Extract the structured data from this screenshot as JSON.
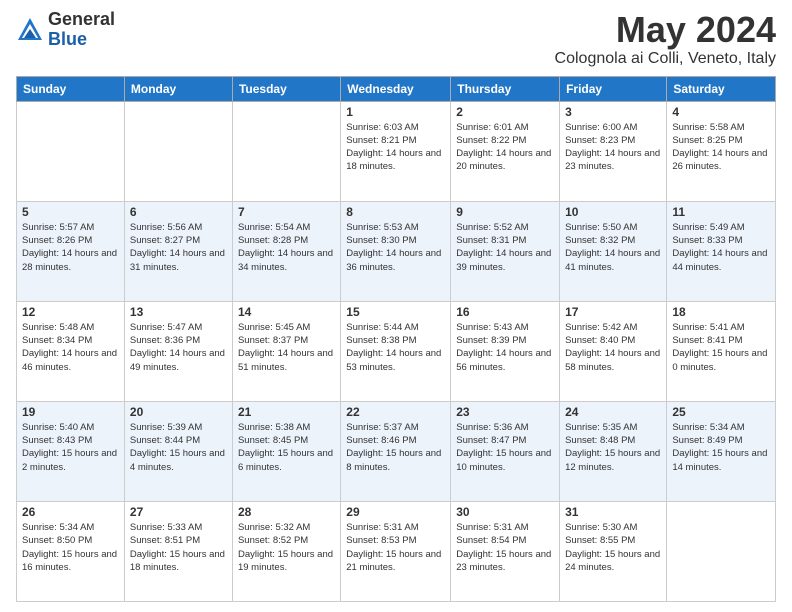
{
  "logo": {
    "general": "General",
    "blue": "Blue"
  },
  "title": "May 2024",
  "location": "Colognola ai Colli, Veneto, Italy",
  "days_of_week": [
    "Sunday",
    "Monday",
    "Tuesday",
    "Wednesday",
    "Thursday",
    "Friday",
    "Saturday"
  ],
  "weeks": [
    [
      {
        "day": "",
        "info": ""
      },
      {
        "day": "",
        "info": ""
      },
      {
        "day": "",
        "info": ""
      },
      {
        "day": "1",
        "info": "Sunrise: 6:03 AM\nSunset: 8:21 PM\nDaylight: 14 hours\nand 18 minutes."
      },
      {
        "day": "2",
        "info": "Sunrise: 6:01 AM\nSunset: 8:22 PM\nDaylight: 14 hours\nand 20 minutes."
      },
      {
        "day": "3",
        "info": "Sunrise: 6:00 AM\nSunset: 8:23 PM\nDaylight: 14 hours\nand 23 minutes."
      },
      {
        "day": "4",
        "info": "Sunrise: 5:58 AM\nSunset: 8:25 PM\nDaylight: 14 hours\nand 26 minutes."
      }
    ],
    [
      {
        "day": "5",
        "info": "Sunrise: 5:57 AM\nSunset: 8:26 PM\nDaylight: 14 hours\nand 28 minutes."
      },
      {
        "day": "6",
        "info": "Sunrise: 5:56 AM\nSunset: 8:27 PM\nDaylight: 14 hours\nand 31 minutes."
      },
      {
        "day": "7",
        "info": "Sunrise: 5:54 AM\nSunset: 8:28 PM\nDaylight: 14 hours\nand 34 minutes."
      },
      {
        "day": "8",
        "info": "Sunrise: 5:53 AM\nSunset: 8:30 PM\nDaylight: 14 hours\nand 36 minutes."
      },
      {
        "day": "9",
        "info": "Sunrise: 5:52 AM\nSunset: 8:31 PM\nDaylight: 14 hours\nand 39 minutes."
      },
      {
        "day": "10",
        "info": "Sunrise: 5:50 AM\nSunset: 8:32 PM\nDaylight: 14 hours\nand 41 minutes."
      },
      {
        "day": "11",
        "info": "Sunrise: 5:49 AM\nSunset: 8:33 PM\nDaylight: 14 hours\nand 44 minutes."
      }
    ],
    [
      {
        "day": "12",
        "info": "Sunrise: 5:48 AM\nSunset: 8:34 PM\nDaylight: 14 hours\nand 46 minutes."
      },
      {
        "day": "13",
        "info": "Sunrise: 5:47 AM\nSunset: 8:36 PM\nDaylight: 14 hours\nand 49 minutes."
      },
      {
        "day": "14",
        "info": "Sunrise: 5:45 AM\nSunset: 8:37 PM\nDaylight: 14 hours\nand 51 minutes."
      },
      {
        "day": "15",
        "info": "Sunrise: 5:44 AM\nSunset: 8:38 PM\nDaylight: 14 hours\nand 53 minutes."
      },
      {
        "day": "16",
        "info": "Sunrise: 5:43 AM\nSunset: 8:39 PM\nDaylight: 14 hours\nand 56 minutes."
      },
      {
        "day": "17",
        "info": "Sunrise: 5:42 AM\nSunset: 8:40 PM\nDaylight: 14 hours\nand 58 minutes."
      },
      {
        "day": "18",
        "info": "Sunrise: 5:41 AM\nSunset: 8:41 PM\nDaylight: 15 hours\nand 0 minutes."
      }
    ],
    [
      {
        "day": "19",
        "info": "Sunrise: 5:40 AM\nSunset: 8:43 PM\nDaylight: 15 hours\nand 2 minutes."
      },
      {
        "day": "20",
        "info": "Sunrise: 5:39 AM\nSunset: 8:44 PM\nDaylight: 15 hours\nand 4 minutes."
      },
      {
        "day": "21",
        "info": "Sunrise: 5:38 AM\nSunset: 8:45 PM\nDaylight: 15 hours\nand 6 minutes."
      },
      {
        "day": "22",
        "info": "Sunrise: 5:37 AM\nSunset: 8:46 PM\nDaylight: 15 hours\nand 8 minutes."
      },
      {
        "day": "23",
        "info": "Sunrise: 5:36 AM\nSunset: 8:47 PM\nDaylight: 15 hours\nand 10 minutes."
      },
      {
        "day": "24",
        "info": "Sunrise: 5:35 AM\nSunset: 8:48 PM\nDaylight: 15 hours\nand 12 minutes."
      },
      {
        "day": "25",
        "info": "Sunrise: 5:34 AM\nSunset: 8:49 PM\nDaylight: 15 hours\nand 14 minutes."
      }
    ],
    [
      {
        "day": "26",
        "info": "Sunrise: 5:34 AM\nSunset: 8:50 PM\nDaylight: 15 hours\nand 16 minutes."
      },
      {
        "day": "27",
        "info": "Sunrise: 5:33 AM\nSunset: 8:51 PM\nDaylight: 15 hours\nand 18 minutes."
      },
      {
        "day": "28",
        "info": "Sunrise: 5:32 AM\nSunset: 8:52 PM\nDaylight: 15 hours\nand 19 minutes."
      },
      {
        "day": "29",
        "info": "Sunrise: 5:31 AM\nSunset: 8:53 PM\nDaylight: 15 hours\nand 21 minutes."
      },
      {
        "day": "30",
        "info": "Sunrise: 5:31 AM\nSunset: 8:54 PM\nDaylight: 15 hours\nand 23 minutes."
      },
      {
        "day": "31",
        "info": "Sunrise: 5:30 AM\nSunset: 8:55 PM\nDaylight: 15 hours\nand 24 minutes."
      },
      {
        "day": "",
        "info": ""
      }
    ]
  ]
}
